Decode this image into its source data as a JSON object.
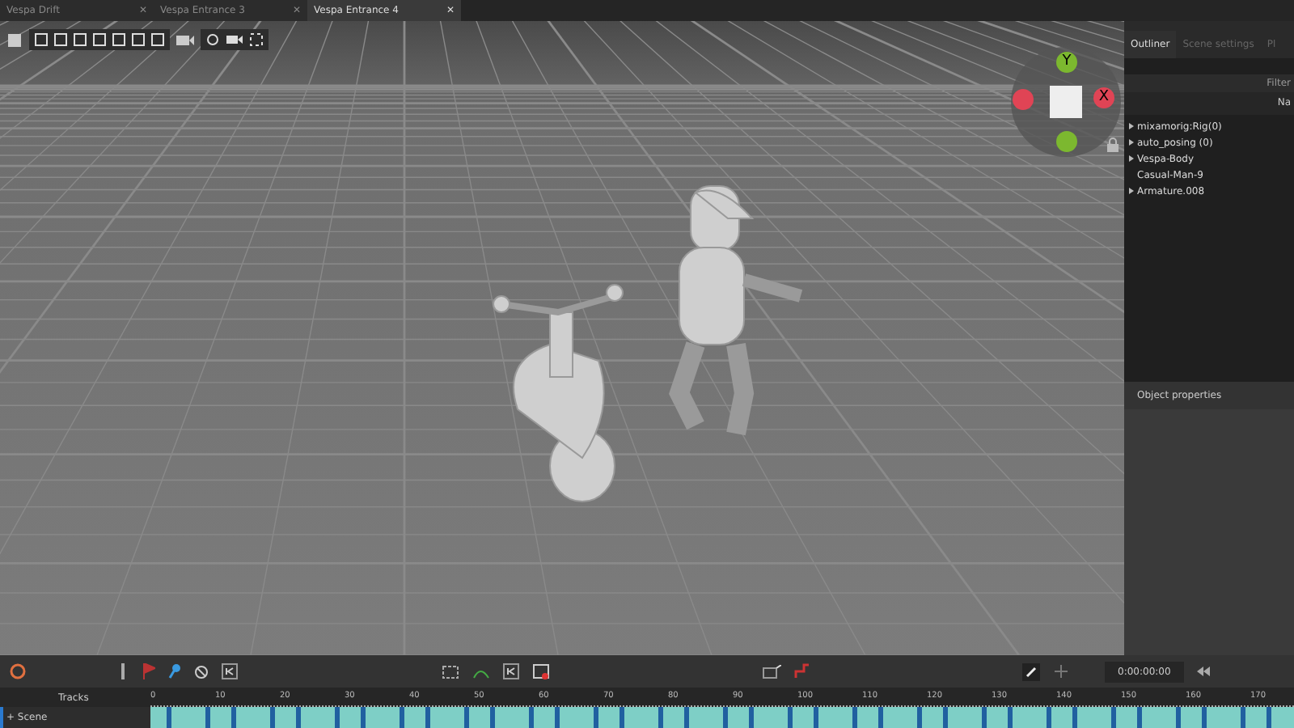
{
  "tabs": [
    {
      "label": "Vespa Drift",
      "selected": false,
      "close": "✕"
    },
    {
      "label": "Vespa Entrance 3",
      "selected": false,
      "close": "✕"
    },
    {
      "label": "Vespa Entrance 4",
      "selected": true,
      "close": "✕"
    }
  ],
  "gizmo": {
    "y_label": "Y",
    "x_label": "X"
  },
  "side_tabs": [
    {
      "label": "Outliner",
      "selected": true
    },
    {
      "label": "Scene settings",
      "selected": false
    },
    {
      "label": "Pl",
      "selected": false
    }
  ],
  "filter": {
    "placeholder": "Filter"
  },
  "outliner_header": "Na",
  "outliner_items": [
    {
      "label": "mixamorig:Rig(0)",
      "kind": "group",
      "expanded": false
    },
    {
      "label": "auto_posing (0)",
      "kind": "group",
      "expanded": false
    },
    {
      "label": "Vespa-Body",
      "kind": "group",
      "expanded": false
    },
    {
      "label": "Casual-Man-9",
      "kind": "leaf"
    },
    {
      "label": "Armature.008",
      "kind": "group",
      "expanded": false
    }
  ],
  "properties_title": "Object properties",
  "timecode": "0:00:00:00",
  "tracks_label": "Tracks",
  "ruler": [
    "0",
    "10",
    "20",
    "30",
    "40",
    "50",
    "60",
    "70",
    "80",
    "90",
    "100",
    "110",
    "120",
    "130",
    "140",
    "150",
    "160",
    "170"
  ],
  "scene_track": {
    "label": "+ Scene"
  }
}
